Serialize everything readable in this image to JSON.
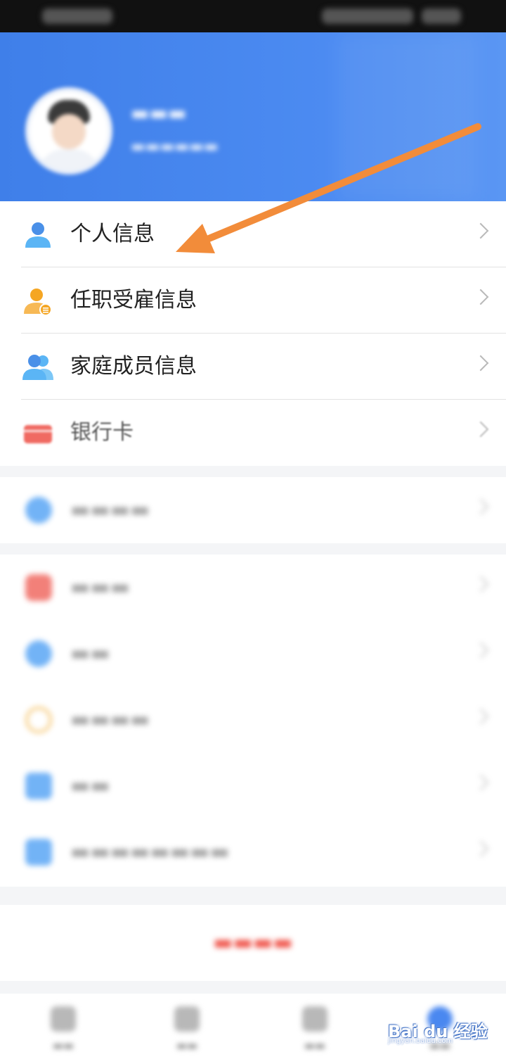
{
  "profile_menu": [
    {
      "label": "个人信息"
    },
    {
      "label": "任职受雇信息"
    },
    {
      "label": "家庭成员信息"
    },
    {
      "label": "银行卡"
    }
  ],
  "accent_colors": {
    "header_blue": "#4a88f0",
    "arrow_orange": "#f28c3a",
    "logout_red": "#f0584e"
  },
  "watermark": {
    "text": "Bai du 经验",
    "sub": "jingyan.baidu.com"
  }
}
